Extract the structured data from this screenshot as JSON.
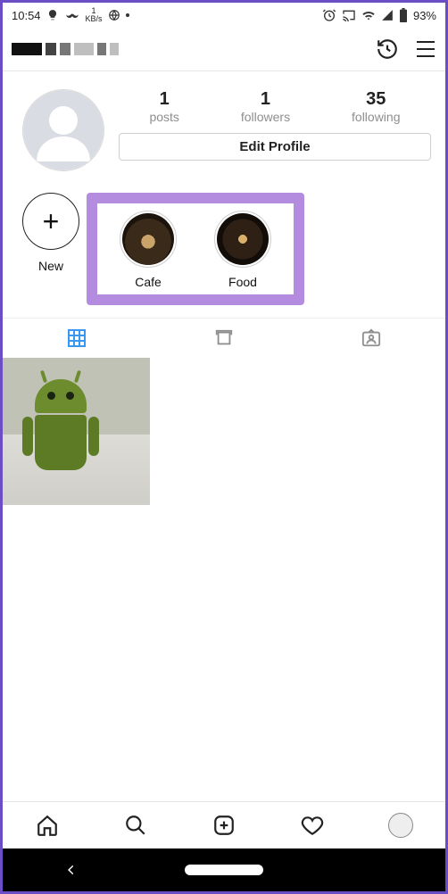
{
  "status": {
    "time": "10:54",
    "kbs_num": "1",
    "kbs_unit": "KB/s",
    "battery": "93%"
  },
  "profile": {
    "posts_count": "1",
    "posts_label": "posts",
    "followers_count": "1",
    "followers_label": "followers",
    "following_count": "35",
    "following_label": "following",
    "edit_label": "Edit Profile"
  },
  "highlights": {
    "new_label": "New",
    "items": [
      {
        "label": "Cafe"
      },
      {
        "label": "Food"
      }
    ]
  }
}
